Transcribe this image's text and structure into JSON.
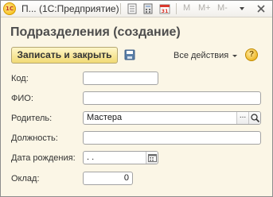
{
  "window": {
    "title": "П... (1С:Предприятие)",
    "buttons": {
      "m": "M",
      "mplus": "M+",
      "mminus": "M-"
    }
  },
  "form": {
    "title": "Подразделения (создание)",
    "save_close_label": "Записать и закрыть",
    "all_actions_label": "Все действия",
    "help_label": "?"
  },
  "fields": {
    "code": {
      "label": "Код:",
      "value": ""
    },
    "fio": {
      "label": "ФИО:",
      "value": ""
    },
    "parent": {
      "label": "Родитель:",
      "value": "Мастера",
      "select_label": "..."
    },
    "position": {
      "label": "Должность:",
      "value": ""
    },
    "birthdate": {
      "label": "Дата рождения:",
      "value": " .  ."
    },
    "salary": {
      "label": "Оклад:",
      "value": "0"
    }
  },
  "colors": {
    "title": "#4d4d4d",
    "form_background": "#fbf6e6",
    "accent_button": "#f1da75"
  }
}
